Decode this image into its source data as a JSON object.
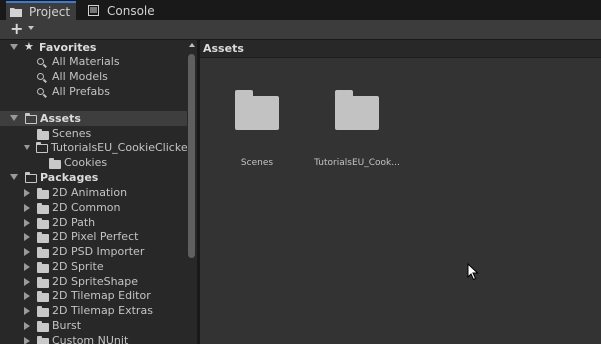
{
  "tabs": [
    {
      "label": "Project",
      "icon": "folder-icon",
      "active": true
    },
    {
      "label": "Console",
      "icon": "console-icon",
      "active": false
    }
  ],
  "toolbar": {
    "create_label": "+"
  },
  "favorites": {
    "title": "Favorites",
    "items": [
      "All Materials",
      "All Models",
      "All Prefabs"
    ]
  },
  "assets_tree": {
    "title": "Assets",
    "items": [
      {
        "label": "Scenes"
      },
      {
        "label": "TutorialsEU_CookieClicke"
      },
      {
        "label": "Cookies"
      }
    ]
  },
  "packages": {
    "title": "Packages",
    "items": [
      "2D Animation",
      "2D Common",
      "2D Path",
      "2D Pixel Perfect",
      "2D PSD Importer",
      "2D Sprite",
      "2D SpriteShape",
      "2D Tilemap Editor",
      "2D Tilemap Extras",
      "Burst",
      "Custom NUnit"
    ]
  },
  "main": {
    "breadcrumb": "Assets",
    "assets": [
      {
        "label": "Scenes"
      },
      {
        "label": "TutorialsEU_Cook..."
      }
    ]
  },
  "colors": {
    "accent": "#3a7bd5",
    "panel": "#282828",
    "grid": "#333333"
  }
}
